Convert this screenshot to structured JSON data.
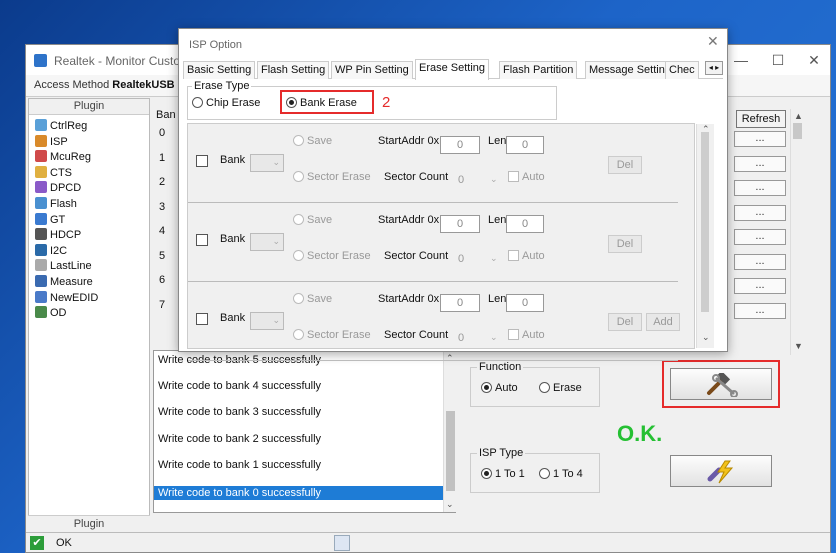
{
  "main": {
    "title": "Realtek - Monitor Custon",
    "access_method_label": "Access Method",
    "access_method_value": "RealtekUSB",
    "plugin_header": "Plugin",
    "plugin_footer": "Plugin",
    "plugins": [
      {
        "label": "CtrlReg",
        "icon": "ctrlreg-icon",
        "color": "#5aa0d8"
      },
      {
        "label": "ISP",
        "icon": "isp-icon",
        "color": "#d98a2a"
      },
      {
        "label": "McuReg",
        "icon": "mcureg-icon",
        "color": "#d04a4a"
      },
      {
        "label": "CTS",
        "icon": "cts-icon",
        "color": "#e0b040"
      },
      {
        "label": "DPCD",
        "icon": "dpcd-icon",
        "color": "#8a5ac8"
      },
      {
        "label": "Flash",
        "icon": "flash-icon",
        "color": "#4a90d0"
      },
      {
        "label": "GT",
        "icon": "gt-icon",
        "color": "#3a7ad0"
      },
      {
        "label": "HDCP",
        "icon": "hdcp-icon",
        "color": "#555555"
      },
      {
        "label": "I2C",
        "icon": "i2c-icon",
        "color": "#2a6aa8"
      },
      {
        "label": "LastLine",
        "icon": "lastline-icon",
        "color": "#aaaaaa"
      },
      {
        "label": "Measure",
        "icon": "measure-icon",
        "color": "#3a6ab0"
      },
      {
        "label": "NewEDID",
        "icon": "newedid-icon",
        "color": "#4a7ac8"
      },
      {
        "label": "OD",
        "icon": "od-icon",
        "color": "#4a8a4a"
      }
    ],
    "bank_header": "Ban",
    "bank_rows": [
      "0",
      "1",
      "2",
      "3",
      "4",
      "5",
      "6",
      "7"
    ],
    "refresh_label": "Refresh",
    "dots_label": "...",
    "log": [
      "Write code to bank 5 successfully",
      "Write code to bank 4 successfully",
      "Write code to bank 3 successfully",
      "Write code to bank 2 successfully",
      "Write code to bank 1 successfully",
      "Write code to bank 0 successfully"
    ],
    "function": {
      "title": "Function",
      "auto": "Auto",
      "erase": "Erase"
    },
    "isp_type": {
      "title": "ISP Type",
      "one_to_one": "1 To 1",
      "one_to_four": "1 To 4"
    },
    "ok_annotation": "O.K.",
    "status_text": "OK"
  },
  "dialog": {
    "title": "ISP Option",
    "tabs": [
      "Basic Setting",
      "Flash Setting",
      "WP Pin Setting",
      "Erase Setting",
      "Flash Partition",
      "Message Setting",
      "Chec"
    ],
    "active_tab": "Erase Setting",
    "erase_type_title": "Erase Type",
    "chip_erase": "Chip Erase",
    "bank_erase": "Bank Erase",
    "annotation_number": "2",
    "bank_label": "Bank",
    "save_label": "Save",
    "sector_erase_label": "Sector Erase",
    "start_addr_label": "StartAddr 0x",
    "len_label": "Len",
    "sector_count_label": "Sector Count",
    "auto_label": "Auto",
    "del_label": "Del",
    "add_label": "Add",
    "field_value": "0"
  },
  "colors": {
    "annotation_red": "#e52b2b",
    "ok_green": "#25c033",
    "selection": "#1e7cd6"
  }
}
